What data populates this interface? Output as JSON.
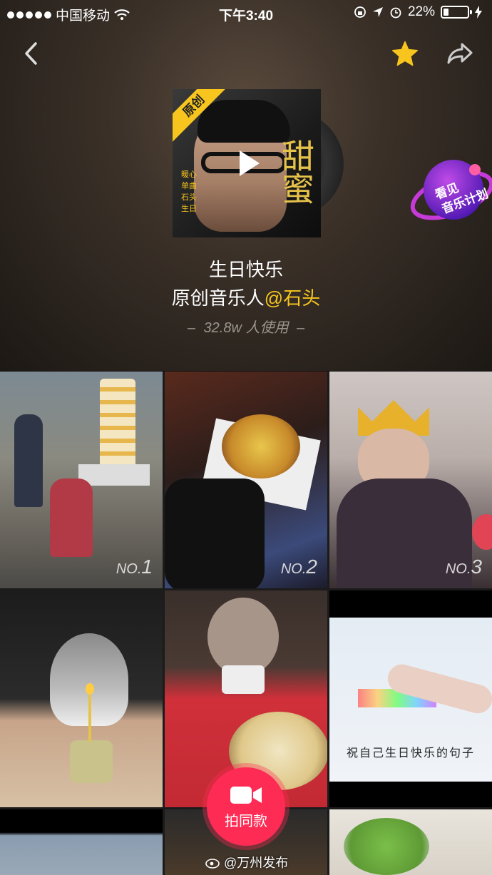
{
  "status_bar": {
    "carrier": "中国移动",
    "time": "下午3:40",
    "battery": "22%",
    "battery_level": 0.22
  },
  "header": {
    "back_icon": "chevron-left-icon",
    "favorite_icon": "star-icon",
    "share_icon": "share-arrow-icon"
  },
  "cover": {
    "badge": "原创",
    "calligraphy": "甜蜜",
    "side_text": "暖心 单曲 石头 生日"
  },
  "promo": {
    "line1": "看见",
    "line2": "音乐计划"
  },
  "song": {
    "title": "生日快乐",
    "artist_prefix": "原创音乐人",
    "artist_handle": "@石头",
    "usage": "32.8w 人使用"
  },
  "videos": [
    {
      "rank_prefix": "NO.",
      "rank": "1"
    },
    {
      "rank_prefix": "NO.",
      "rank": "2"
    },
    {
      "rank_prefix": "NO.",
      "rank": "3"
    },
    {
      "rank_prefix": "",
      "rank": ""
    },
    {
      "rank_prefix": "",
      "rank": ""
    },
    {
      "rank_prefix": "",
      "rank": "",
      "caption": "祝自己生日快乐的句子"
    }
  ],
  "fab": {
    "label": "拍同款",
    "icon": "video-camera-icon"
  },
  "watermark": "@万州发布",
  "colors": {
    "accent": "#fe2c55",
    "highlight": "#f7c51e"
  }
}
